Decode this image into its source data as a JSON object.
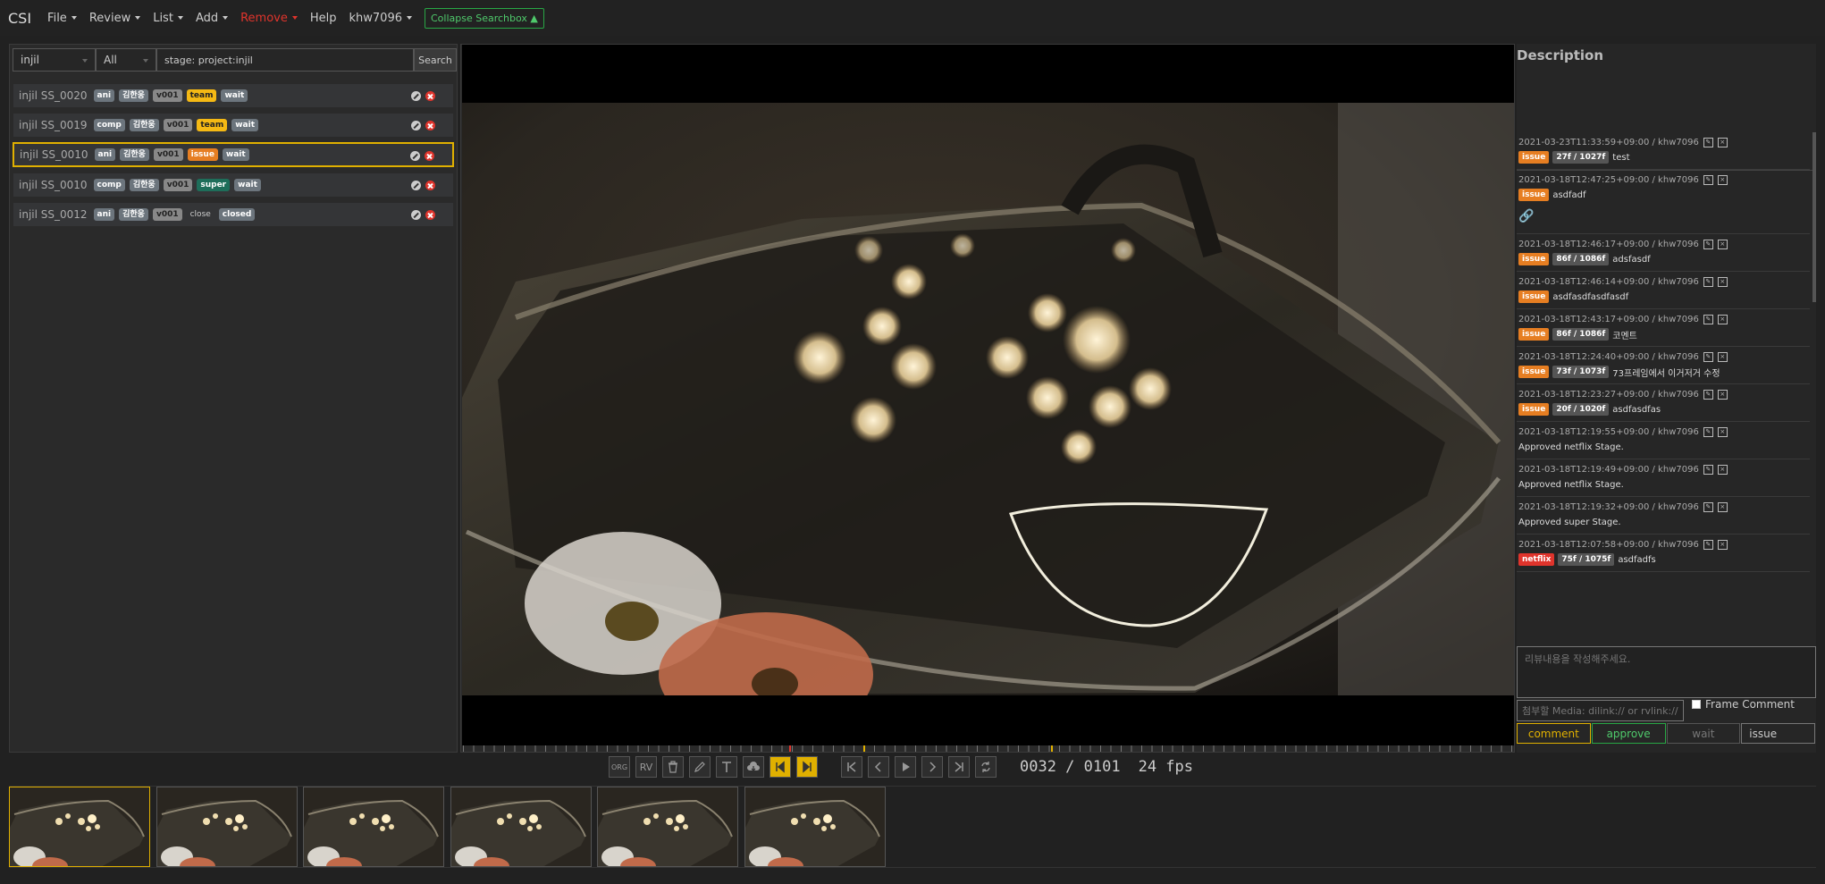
{
  "navbar": {
    "brand": "CSI",
    "menu": [
      {
        "label": "File",
        "has_caret": true
      },
      {
        "label": "Review",
        "has_caret": true
      },
      {
        "label": "List",
        "has_caret": true
      },
      {
        "label": "Add",
        "has_caret": true
      },
      {
        "label": "Remove",
        "has_caret": true,
        "color": "#e0342c"
      },
      {
        "label": "Help",
        "has_caret": false
      },
      {
        "label": "khw7096",
        "has_caret": true
      }
    ],
    "collapse_button": "Collapse Searchbox ▲"
  },
  "search": {
    "project": "injil",
    "filter": "All",
    "query": "stage: project:injil",
    "button": "Search"
  },
  "shots": [
    {
      "name": "injil SS_0020",
      "task": "ani",
      "artist": "김한웅",
      "version": "v001",
      "stage": "team",
      "status": "wait",
      "selected": false
    },
    {
      "name": "injil SS_0019",
      "task": "comp",
      "artist": "김한웅",
      "version": "v001",
      "stage": "team",
      "status": "wait",
      "selected": false
    },
    {
      "name": "injil SS_0010",
      "task": "ani",
      "artist": "김한웅",
      "version": "v001",
      "stage": "issue",
      "status": "wait",
      "selected": true
    },
    {
      "name": "injil SS_0010",
      "task": "comp",
      "artist": "김한웅",
      "version": "v001",
      "stage": "super",
      "status": "wait",
      "selected": false
    },
    {
      "name": "injil SS_0012",
      "task": "ani",
      "artist": "김한웅",
      "version": "v001",
      "stage": "close",
      "status": "closed",
      "selected": false
    }
  ],
  "player": {
    "buttons": [
      "ORG",
      "RV",
      "trash-icon",
      "pencil-icon",
      "text-icon",
      "cloud-download-icon",
      "set-in-icon",
      "set-out-icon",
      "first-frame-icon",
      "prev-frame-icon",
      "play-icon",
      "next-frame-icon",
      "last-frame-icon",
      "loop-icon"
    ],
    "frame_counter": "0032 / 0101",
    "fps": "24 fps"
  },
  "thumbnails_count": 6,
  "description": {
    "title": "Description",
    "comments": [
      {
        "meta": "2021-03-23T11:33:59+09:00 / khw7096",
        "tag": "issue",
        "frame": "27f / 1027f",
        "text": "test"
      },
      {
        "meta": "2021-03-18T12:47:25+09:00 / khw7096",
        "tag": "issue",
        "frame": "",
        "text": "asdfadf",
        "link": "🔗"
      },
      {
        "meta": "2021-03-18T12:46:17+09:00 / khw7096",
        "tag": "issue",
        "frame": "86f / 1086f",
        "text": "adsfasdf"
      },
      {
        "meta": "2021-03-18T12:46:14+09:00 / khw7096",
        "tag": "issue",
        "frame": "",
        "text": "asdfasdfasdfasdf"
      },
      {
        "meta": "2021-03-18T12:43:17+09:00 / khw7096",
        "tag": "issue",
        "frame": "86f / 1086f",
        "text": "코멘트"
      },
      {
        "meta": "2021-03-18T12:24:40+09:00 / khw7096",
        "tag": "issue",
        "frame": "73f / 1073f",
        "text": "73프레임에서 이거저거 수정"
      },
      {
        "meta": "2021-03-18T12:23:27+09:00 / khw7096",
        "tag": "issue",
        "frame": "20f / 1020f",
        "text": "asdfasdfas"
      },
      {
        "meta": "2021-03-18T12:19:55+09:00 / khw7096",
        "tag": "",
        "frame": "",
        "text": "Approved netflix Stage."
      },
      {
        "meta": "2021-03-18T12:19:49+09:00 / khw7096",
        "tag": "",
        "frame": "",
        "text": "Approved netflix Stage."
      },
      {
        "meta": "2021-03-18T12:19:32+09:00 / khw7096",
        "tag": "",
        "frame": "",
        "text": "Approved super Stage."
      },
      {
        "meta": "2021-03-18T12:07:58+09:00 / khw7096",
        "tag": "netflix",
        "frame": "75f / 1075f",
        "text": "asdfadfs"
      }
    ],
    "review_placeholder": "리뷰내용을 작성해주세요.",
    "media_placeholder": "첨부할 Media: dilink:// or rvlink://",
    "frame_comment_label": "Frame Comment",
    "buttons": {
      "comment": "comment",
      "approve": "approve",
      "wait": "wait",
      "status": "issue"
    }
  }
}
